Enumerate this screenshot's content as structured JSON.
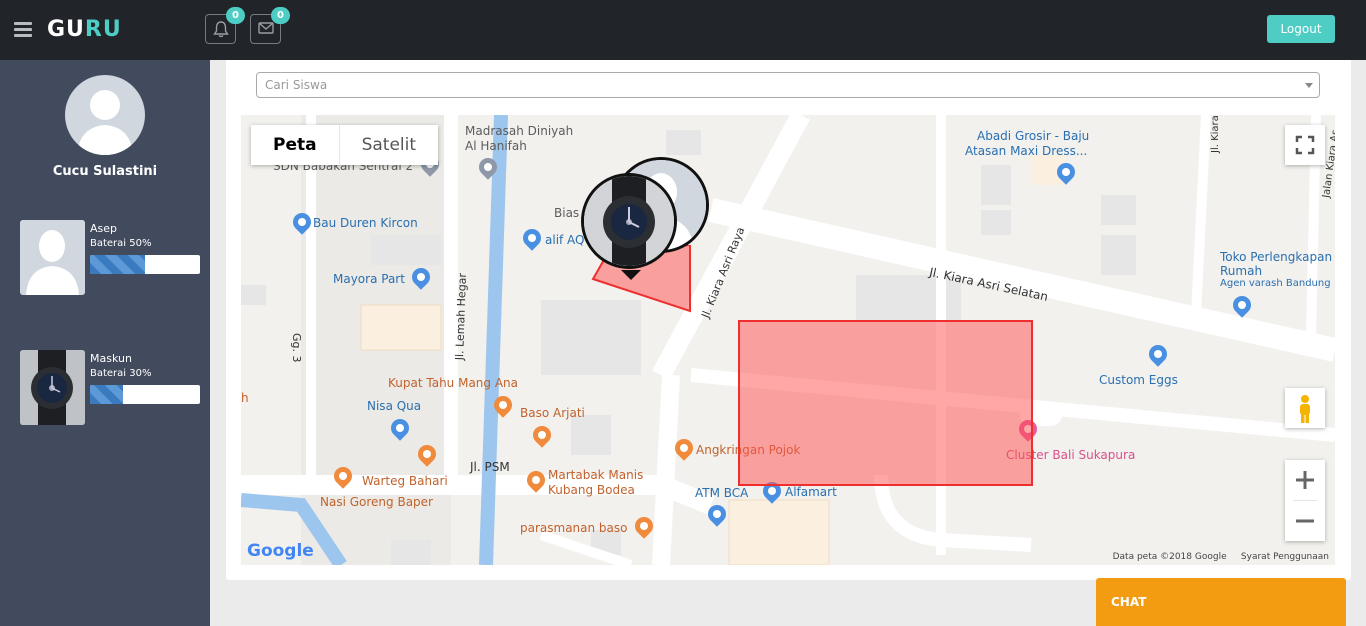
{
  "app": {
    "brand_part1": "GU",
    "brand_part2": "RU",
    "logout_label": "Logout",
    "notifications_count": "0",
    "messages_count": "0",
    "accent_color": "#4ecdc4"
  },
  "sidebar": {
    "profile_name": "Cucu Sulastini",
    "students": [
      {
        "name": "Asep",
        "battery_label": "Baterai 50%",
        "battery_fraction": 0.5
      },
      {
        "name": "Maskun",
        "battery_label": "Baterai 30%",
        "battery_fraction": 0.3
      }
    ]
  },
  "search": {
    "placeholder": "Cari Siswa"
  },
  "map": {
    "type_buttons": [
      "Peta",
      "Satelit"
    ],
    "labels": {
      "sdn": "SDN Babakan Sentral 2",
      "madrasah_1": "Madrasah Diniyah",
      "madrasah_2": "Al Hanifah",
      "bau_duren": "Bau Duren Kircon",
      "mayora": "Mayora Part",
      "alif": "alif AQ",
      "bias": "Bias",
      "abadi_1": "Abadi Grosir - Baju",
      "abadi_2": "Atasan Maxi Dress...",
      "kiara_asri_selatan": "Jl. Kiara Asri Selatan",
      "kiara_asri_raya": "Jl. Kiara Asri Raya",
      "jl_kiara": "Jl. Kiara",
      "jalan_kiara": "Jalan Kiara As",
      "toko_1": "Toko Perlengkapan",
      "toko_2": "Rumah",
      "toko_3": "Agen varash Bandung",
      "custom_eggs": "Custom Eggs",
      "gg3": "Gg. 3",
      "lemah_hegar": "Jl. Lemah Hegar",
      "kupat": "Kupat Tahu Mang Ana",
      "nisa": "Nisa Qua",
      "baso_arjati": "Baso Arjati",
      "angkringan": "Angkringan Pojok",
      "cluster": "Cluster Bali Sukapura",
      "jl_psm": "Jl. PSM",
      "warteg": "Warteg Bahari",
      "nasi_goreng": "Nasi Goreng Baper",
      "martabak_1": "Martabak Manis",
      "martabak_2": "Kubang Bodea",
      "atm_bca": "ATM BCA",
      "alfamart": "Alfamart",
      "parasmanan": "parasmanan baso",
      "h": "h"
    },
    "attribution": "Data peta ©2018 Google",
    "terms": "Syarat Penggunaan",
    "google_logo": "Google"
  },
  "chat": {
    "label": "CHAT"
  }
}
